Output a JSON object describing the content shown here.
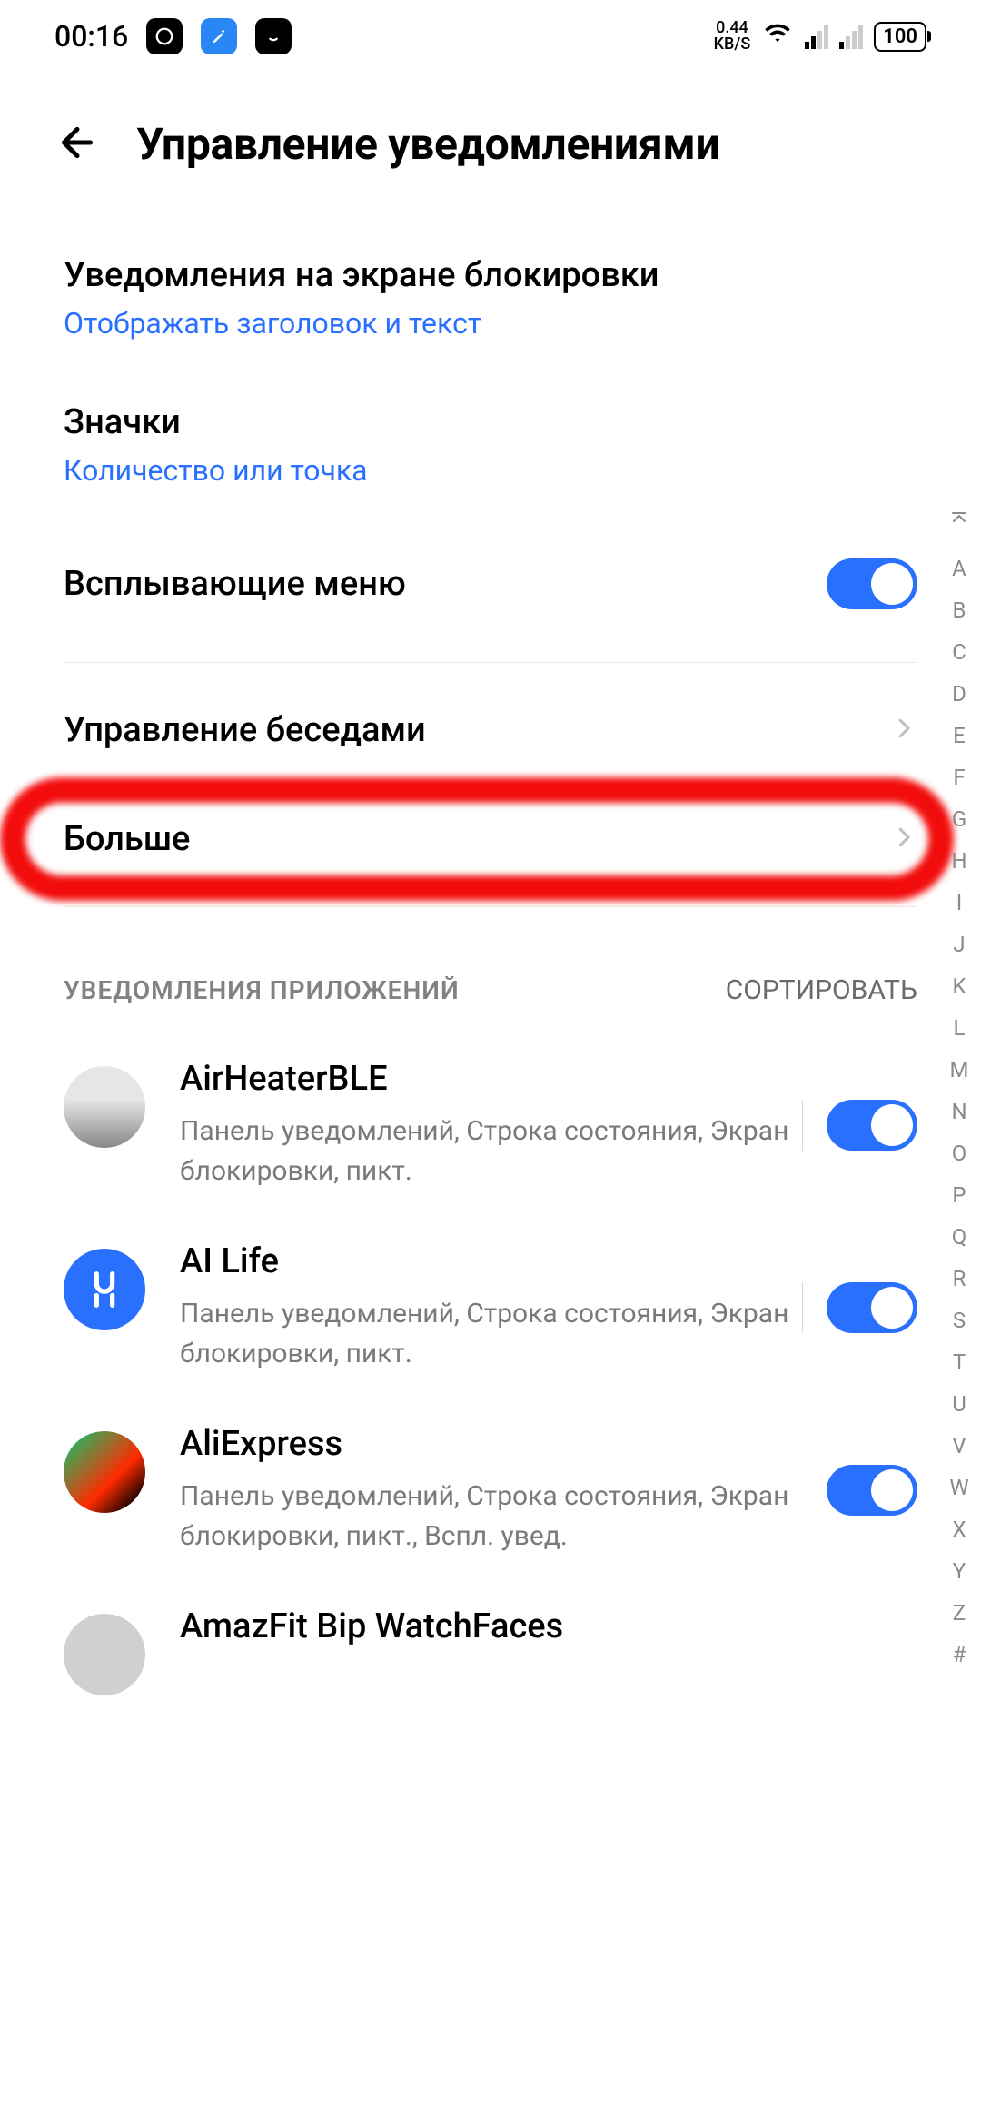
{
  "status": {
    "time": "00:16",
    "kbs_value": "0.44",
    "kbs_unit": "KB/S",
    "battery": "100"
  },
  "header": {
    "title": "Управление уведомлениями"
  },
  "settings": {
    "lock_screen": {
      "title": "Уведомления на экране блокировки",
      "sub": "Отображать заголовок и текст"
    },
    "badges": {
      "title": "Значки",
      "sub": "Количество или точка"
    },
    "popup": {
      "title": "Всплывающие меню"
    },
    "conversations": {
      "title": "Управление беседами"
    },
    "more": {
      "title": "Больше"
    }
  },
  "section": {
    "apps_label": "УВЕДОМЛЕНИЯ ПРИЛОЖЕНИЙ",
    "sort_label": "СОРТИРОВАТЬ"
  },
  "apps": [
    {
      "name": "AirHeaterBLE",
      "desc": "Панель уведомлений, Строка состояния, Экран блокировки, пикт.",
      "icon_bg": "linear-gradient(180deg,#e6e6e6 40%,#888 100%)",
      "has_sep": true
    },
    {
      "name": "AI Life",
      "desc": "Панель уведомлений, Строка состояния, Экран блокировки, пикт.",
      "icon_bg": "#2970ff",
      "has_sep": true
    },
    {
      "name": "AliExpress",
      "desc": "Панель уведомлений, Строка состояния, Экран блокировки, пикт., Вспл. увед.",
      "icon_bg": "linear-gradient(135deg,#00d070,#ff2a00 60%,#000 90%)",
      "has_sep": false
    },
    {
      "name": "AmazFit Bip WatchFaces",
      "desc": "",
      "icon_bg": "#d0d0d0",
      "has_sep": false
    }
  ],
  "alpha_index": [
    "A",
    "B",
    "C",
    "D",
    "E",
    "F",
    "G",
    "H",
    "I",
    "J",
    "K",
    "L",
    "M",
    "N",
    "O",
    "P",
    "Q",
    "R",
    "S",
    "T",
    "U",
    "V",
    "W",
    "X",
    "Y",
    "Z",
    "#"
  ]
}
